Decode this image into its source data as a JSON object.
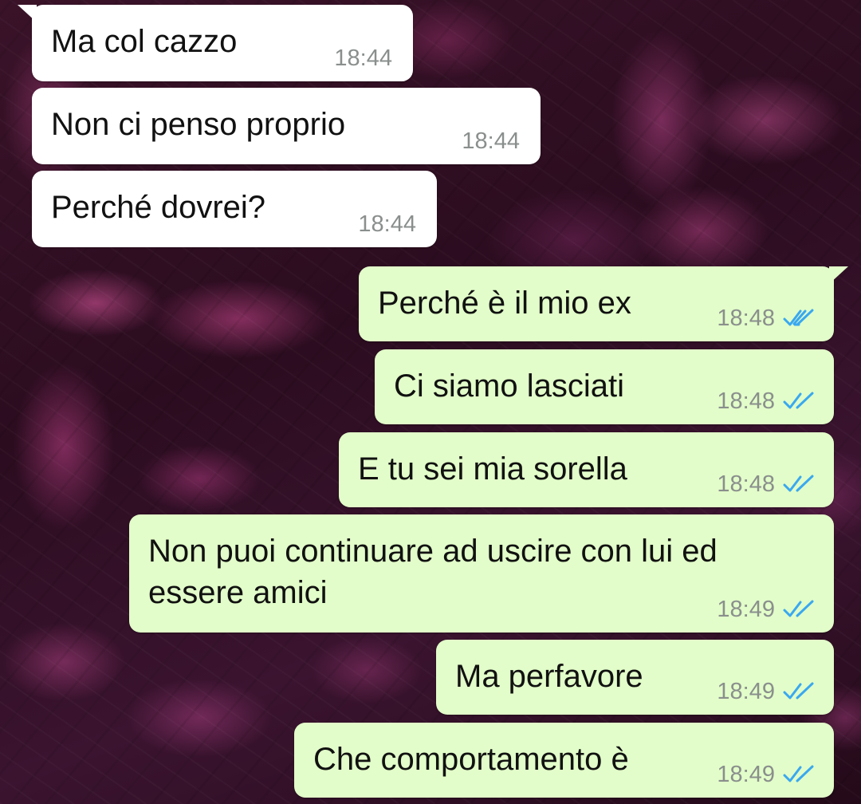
{
  "conversation": {
    "messages": [
      {
        "direction": "incoming",
        "text": "Ma col cazzo",
        "time": "18:44"
      },
      {
        "direction": "incoming",
        "text": "Non ci penso proprio",
        "time": "18:44"
      },
      {
        "direction": "incoming",
        "text": "Perché dovrei?",
        "time": "18:44"
      },
      {
        "direction": "outgoing",
        "text": "Perché è il mio ex",
        "time": "18:48",
        "status_icon": "double-check-read-icon"
      },
      {
        "direction": "outgoing",
        "text": "Ci siamo lasciati",
        "time": "18:48",
        "status_icon": "double-check-read-icon"
      },
      {
        "direction": "outgoing",
        "text": "E tu sei mia sorella",
        "time": "18:48",
        "status_icon": "double-check-read-icon"
      },
      {
        "direction": "outgoing",
        "text": "Non puoi continuare ad uscire con lui ed essere amici",
        "time": "18:49",
        "status_icon": "double-check-read-icon"
      },
      {
        "direction": "outgoing",
        "text": "Ma perfavore",
        "time": "18:49",
        "status_icon": "double-check-read-icon"
      },
      {
        "direction": "outgoing",
        "text": "Che comportamento è",
        "time": "18:49",
        "status_icon": "double-check-read-icon"
      }
    ]
  },
  "colors": {
    "incoming_bubble": "#ffffff",
    "outgoing_bubble": "#e2fdc9",
    "read_ticks": "#3aa8f0",
    "timestamp": "#8a8f8d",
    "wallpaper": "#2b0c1f"
  }
}
